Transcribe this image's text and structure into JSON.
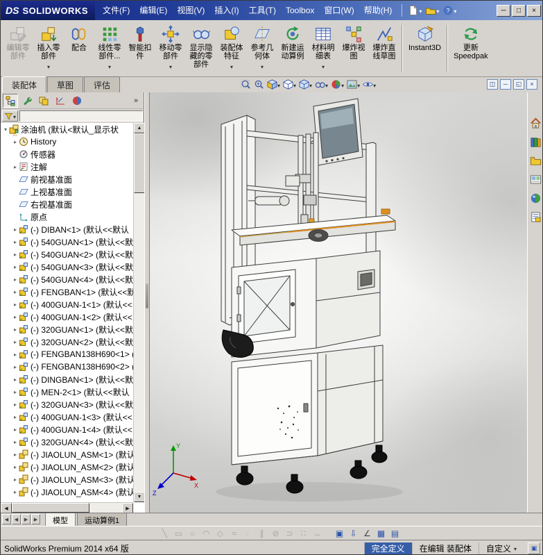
{
  "titlebar": {
    "logo_mark": "DS",
    "logo_text": "SOLIDWORKS",
    "menus": [
      "文件(F)",
      "编辑(E)",
      "视图(V)",
      "插入(I)",
      "工具(T)",
      "Toolbox",
      "窗口(W)",
      "帮助(H)"
    ],
    "quick_access": [
      {
        "name": "new-document-button",
        "icon": "q-new",
        "caret": true
      },
      {
        "name": "open-document-button",
        "icon": "q-open",
        "caret": true
      },
      {
        "name": "help-button",
        "icon": "q-help",
        "caret": true
      }
    ],
    "window_controls": [
      {
        "name": "minimize-button",
        "glyph": "─"
      },
      {
        "name": "maximize-button",
        "glyph": "□"
      },
      {
        "name": "close-button",
        "glyph": "×"
      }
    ]
  },
  "command_manager": {
    "buttons": [
      {
        "name": "edit-component-button",
        "icon": "ic-editcomp",
        "label": "编辑零\n部件",
        "state": "disabled"
      },
      {
        "name": "insert-components-button",
        "icon": "ic-insert",
        "label": "插入零\n部件",
        "caret": true
      },
      {
        "name": "mate-button",
        "icon": "ic-mate",
        "label": "配合"
      },
      {
        "name": "linear-component-pattern-button",
        "icon": "ic-pattern",
        "label": "线性零\n部件...",
        "caret": true
      },
      {
        "name": "smart-fasteners-button",
        "icon": "ic-fastener",
        "label": "智能扣\n件"
      },
      {
        "name": "move-component-button",
        "icon": "ic-move",
        "label": "移动零\n部件",
        "caret": true
      },
      {
        "name": "show-hidden-components-button",
        "icon": "ic-showhide",
        "label": "显示隐\n藏的零\n部件"
      },
      {
        "name": "assembly-features-button",
        "icon": "ic-asmfeat",
        "label": "装配体\n特征",
        "caret": true
      },
      {
        "name": "reference-geometry-button",
        "icon": "ic-refgeo",
        "label": "参考几\n何体",
        "caret": true
      },
      {
        "name": "new-motion-study-button",
        "icon": "ic-motion",
        "label": "新建运\n动算例"
      },
      {
        "name": "bill-of-materials-button",
        "icon": "ic-bom",
        "label": "材料明\n细表",
        "caret": true
      },
      {
        "name": "exploded-view-button",
        "icon": "ic-explode",
        "label": "爆炸视\n图"
      },
      {
        "name": "explode-line-sketch-button",
        "icon": "ic-explsk",
        "label": "爆炸直\n线草图",
        "sep": true
      },
      {
        "name": "instant3d-button",
        "icon": "ic-instant3d",
        "label": "Instant3D",
        "sep": true
      },
      {
        "name": "update-speedpak-button",
        "icon": "ic-speedpak",
        "label": "更新\nSpeedpak"
      }
    ]
  },
  "ribbon_tabs": [
    {
      "name": "tab-assembly",
      "label": "装配体",
      "state": "active"
    },
    {
      "name": "tab-sketch",
      "label": "草图"
    },
    {
      "name": "tab-evaluate",
      "label": "评估"
    }
  ],
  "heads_up": {
    "icons": [
      {
        "name": "zoom-to-fit-button",
        "icon": "h-zoomfit"
      },
      {
        "name": "zoom-to-area-button",
        "icon": "h-zoomarea"
      },
      {
        "name": "section-view-button",
        "icon": "h-section",
        "caret": true
      },
      {
        "name": "view-orientation-button",
        "icon": "h-orient",
        "caret": true
      },
      {
        "name": "display-style-button",
        "icon": "h-display",
        "caret": true
      },
      {
        "name": "hide-show-items-button",
        "icon": "h-hideshow",
        "caret": true
      },
      {
        "name": "edit-appearance-button",
        "icon": "h-appearance",
        "caret": true
      },
      {
        "name": "apply-scene-button",
        "icon": "h-scene",
        "caret": true
      },
      {
        "name": "view-settings-button",
        "icon": "h-settings",
        "caret": true
      }
    ]
  },
  "doc_controls": [
    {
      "name": "doc-window-button",
      "glyph": "◫"
    },
    {
      "name": "doc-minimize-button",
      "glyph": "─"
    },
    {
      "name": "doc-restore-button",
      "glyph": "◱"
    },
    {
      "name": "doc-close-button",
      "glyph": "×"
    }
  ],
  "feature_tree": {
    "manager_tabs": [
      {
        "name": "featuremanager-tab",
        "icon": "m-feature",
        "state": "active"
      },
      {
        "name": "propertymanager-tab",
        "icon": "m-property"
      },
      {
        "name": "configurationmanager-tab",
        "icon": "m-config"
      },
      {
        "name": "dimxpertmanager-tab",
        "icon": "m-dimxpert"
      },
      {
        "name": "displaymanager-tab",
        "icon": "m-display"
      }
    ],
    "items": [
      {
        "label": "涂油机 (默认<默认_显示状",
        "icon": "i-asmroot",
        "icon_name": "assembly-icon",
        "arrow": "ad",
        "cls": "rt",
        "warn": true
      },
      {
        "label": "History",
        "icon": "i-history",
        "icon_name": "history-folder-icon",
        "arrow": "ar"
      },
      {
        "label": "传感器",
        "icon": "i-sensor",
        "icon_name": "sensors-folder-icon",
        "arrow": ""
      },
      {
        "label": "注解",
        "icon": "i-anno",
        "icon_name": "annotations-folder-icon",
        "arrow": "ar"
      },
      {
        "label": "前视基准面",
        "icon": "i-plane",
        "icon_name": "front-plane-icon",
        "arrow": ""
      },
      {
        "label": "上视基准面",
        "icon": "i-plane",
        "icon_name": "top-plane-icon",
        "arrow": ""
      },
      {
        "label": "右视基准面",
        "icon": "i-plane",
        "icon_name": "right-plane-icon",
        "arrow": ""
      },
      {
        "label": "原点",
        "icon": "i-origin",
        "icon_name": "origin-icon",
        "arrow": ""
      },
      {
        "label": "(-) DIBAN<1> (默认<<默认",
        "icon": "i-comp",
        "icon_name": "component-icon",
        "arrow": "ar"
      },
      {
        "label": "(-) 540GUAN<1> (默认<<默",
        "icon": "i-comp",
        "icon_name": "component-icon",
        "arrow": "ar"
      },
      {
        "label": "(-) 540GUAN<2> (默认<<默",
        "icon": "i-comp",
        "icon_name": "component-icon",
        "arrow": "ar"
      },
      {
        "label": "(-) 540GUAN<3> (默认<<默",
        "icon": "i-comp",
        "icon_name": "component-icon",
        "arrow": "ar"
      },
      {
        "label": "(-) 540GUAN<4> (默认<<默",
        "icon": "i-comp",
        "icon_name": "component-icon",
        "arrow": "ar"
      },
      {
        "label": "(-) FENGBAN<1> (默认<<默",
        "icon": "i-comp",
        "icon_name": "component-icon",
        "arrow": "ar"
      },
      {
        "label": "(-) 400GUAN-1<1> (默认<<",
        "icon": "i-comp",
        "icon_name": "component-icon",
        "arrow": "ar"
      },
      {
        "label": "(-) 400GUAN-1<2> (默认<<",
        "icon": "i-comp",
        "icon_name": "component-icon",
        "arrow": "ar"
      },
      {
        "label": "(-) 320GUAN<1> (默认<<默",
        "icon": "i-comp",
        "icon_name": "component-icon",
        "arrow": "ar"
      },
      {
        "label": "(-) 320GUAN<2> (默认<<默",
        "icon": "i-comp",
        "icon_name": "component-icon",
        "arrow": "ar"
      },
      {
        "label": "(-) FENGBAN138H690<1> (",
        "icon": "i-comp",
        "icon_name": "component-icon",
        "arrow": "ar"
      },
      {
        "label": "(-) FENGBAN138H690<2> (",
        "icon": "i-comp",
        "icon_name": "component-icon",
        "arrow": "ar"
      },
      {
        "label": "(-) DINGBAN<1> (默认<<默",
        "icon": "i-comp",
        "icon_name": "component-icon",
        "arrow": "ar"
      },
      {
        "label": "(-) MEN-2<1> (默认<<默认",
        "icon": "i-comp",
        "icon_name": "component-icon",
        "arrow": "ar"
      },
      {
        "label": "(-) 320GUAN<3> (默认<<默",
        "icon": "i-comp",
        "icon_name": "component-icon",
        "arrow": "ar"
      },
      {
        "label": "(-) 400GUAN-1<3> (默认<<",
        "icon": "i-comp",
        "icon_name": "component-icon",
        "arrow": "ar"
      },
      {
        "label": "(-) 400GUAN-1<4> (默认<<",
        "icon": "i-comp",
        "icon_name": "component-icon",
        "arrow": "ar"
      },
      {
        "label": "(-) 320GUAN<4> (默认<<默",
        "icon": "i-comp",
        "icon_name": "component-icon",
        "arrow": "ar"
      },
      {
        "label": "(-) JIAOLUN_ASM<1> (默认",
        "icon": "i-asm",
        "icon_name": "subassembly-icon",
        "arrow": "ar"
      },
      {
        "label": "(-) JIAOLUN_ASM<2> (默认",
        "icon": "i-asm",
        "icon_name": "subassembly-icon",
        "arrow": "ar"
      },
      {
        "label": "(-) JIAOLUN_ASM<3> (默认",
        "icon": "i-asm",
        "icon_name": "subassembly-icon",
        "arrow": "ar"
      },
      {
        "label": "(-) JIAOLUN_ASM<4> (默认",
        "icon": "i-asm",
        "icon_name": "subassembly-icon",
        "arrow": "ar"
      }
    ]
  },
  "task_pane": {
    "icons": [
      {
        "name": "solidworks-resources-button",
        "icon": "r-home"
      },
      {
        "name": "design-library-button",
        "icon": "r-library"
      },
      {
        "name": "file-explorer-button",
        "icon": "r-folder"
      },
      {
        "name": "view-palette-button",
        "icon": "r-palette"
      },
      {
        "name": "appearances-scenes-button",
        "icon": "r-appearances"
      },
      {
        "name": "custom-properties-button",
        "icon": "r-props"
      }
    ]
  },
  "graphics": {
    "triad": {
      "x": "X",
      "y": "Y",
      "z": "Z"
    }
  },
  "doc_tabs": {
    "nav": [
      {
        "name": "first-tab-button",
        "glyph": "◀"
      },
      {
        "name": "previous-tab-button",
        "glyph": "◀"
      },
      {
        "name": "next-tab-button",
        "glyph": "▶"
      },
      {
        "name": "last-tab-button",
        "glyph": "▶"
      }
    ],
    "tabs": [
      {
        "name": "tab-model",
        "label": "模型",
        "state": "active"
      },
      {
        "name": "tab-motion-study-1",
        "label": "运动算例1"
      }
    ]
  },
  "bottom_toolbar": {
    "icons": [
      {
        "name": "sketch-line-icon",
        "glyph": "╲",
        "state": "disabled"
      },
      {
        "name": "sketch-rectangle-icon",
        "glyph": "▭",
        "state": "disabled"
      },
      {
        "name": "sketch-circle-icon",
        "glyph": "○",
        "state": "disabled"
      },
      {
        "name": "sketch-arc-icon",
        "glyph": "◠",
        "state": "disabled"
      },
      {
        "name": "sketch-polygon-icon",
        "glyph": "◇",
        "state": "disabled"
      },
      {
        "name": "sketch-spline-icon",
        "glyph": "≈",
        "state": "disabled"
      },
      {
        "name": "sketch-point-icon",
        "glyph": "∙",
        "state": "disabled"
      },
      {
        "name": "sketch-mirror-icon",
        "glyph": "∥",
        "state": "disabled"
      },
      {
        "name": "sketch-trim-icon",
        "glyph": "⊘",
        "state": "disabled"
      },
      {
        "name": "sketch-offset-icon",
        "glyph": "⊃",
        "state": "disabled"
      },
      {
        "name": "sketch-pattern-icon",
        "glyph": "∷",
        "state": "disabled"
      },
      {
        "name": "sketch-dimension-icon",
        "glyph": "↔",
        "state": "disabled"
      },
      {
        "name": "toolbar-separator",
        "glyph": "",
        "state": "sep"
      },
      {
        "name": "view-cube-icon",
        "glyph": "▣",
        "state": "blue"
      },
      {
        "name": "normal-to-icon",
        "glyph": "⇩",
        "state": "blue"
      },
      {
        "name": "measure-icon",
        "glyph": "∠",
        "state": "dark"
      },
      {
        "name": "table-icon",
        "glyph": "▦",
        "state": "blue"
      },
      {
        "name": "spreadsheet-icon",
        "glyph": "▤",
        "state": "blue"
      }
    ]
  },
  "status_bar": {
    "left": "SolidWorks Premium 2014 x64 版",
    "cells": [
      {
        "name": "definition-status",
        "label": "完全定义",
        "state": "highlight"
      },
      {
        "name": "editing-status",
        "label": "在编辑 装配体"
      },
      {
        "name": "customize-menu",
        "label": "自定义",
        "caret": true
      }
    ],
    "icon_glyph": "▣"
  }
}
